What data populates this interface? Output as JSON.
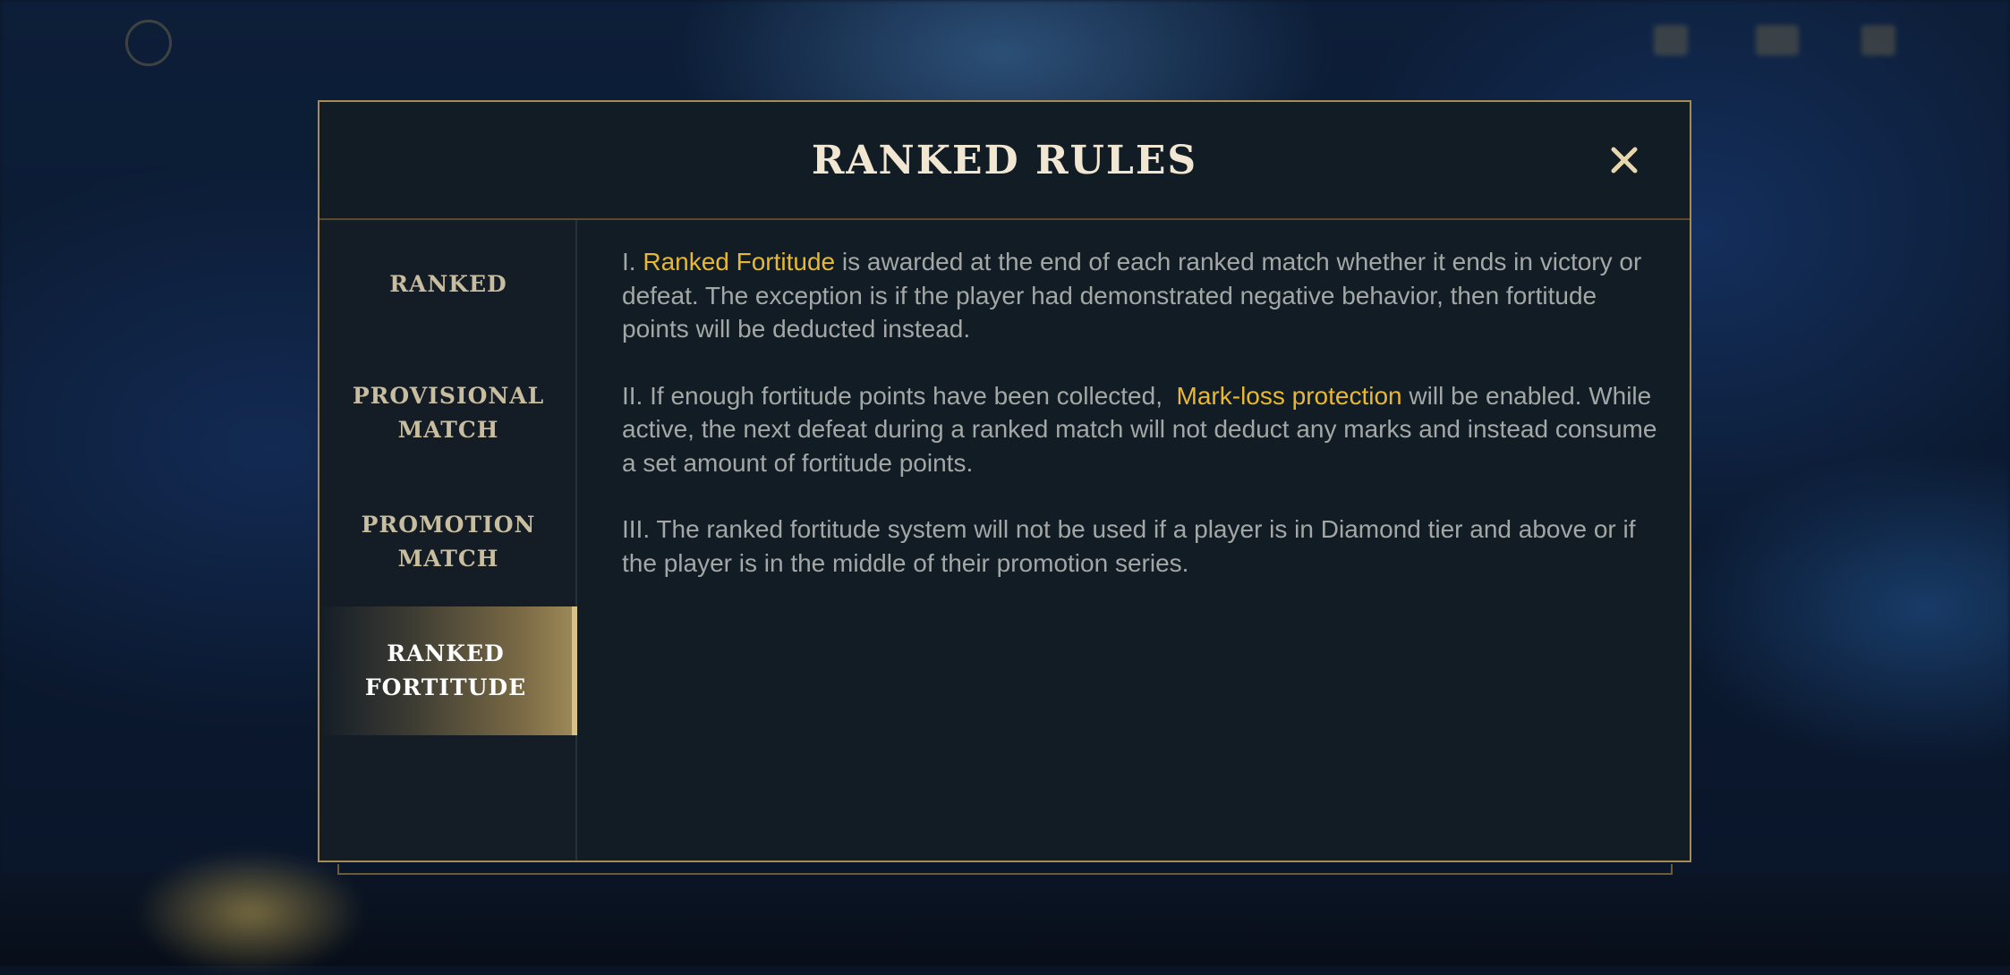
{
  "modal": {
    "title": "RANKED RULES",
    "close_icon": "close-icon"
  },
  "sidebar": {
    "items": [
      {
        "label": "RANKED",
        "active": false
      },
      {
        "label": "PROVISIONAL\nMATCH",
        "active": false
      },
      {
        "label": "PROMOTION\nMATCH",
        "active": false
      },
      {
        "label": "RANKED\nFORTITUDE",
        "active": true
      }
    ]
  },
  "content": {
    "paragraphs": [
      {
        "prefix": "I. ",
        "highlight": "Ranked Fortitude",
        "suffix": " is awarded at the end of each ranked match whether it ends in victory or defeat. The exception is if the player had demonstrated negative behavior, then fortitude points will be deducted instead."
      },
      {
        "prefix": "II. If enough fortitude points have been collected,  ",
        "highlight": "Mark-loss protection",
        "suffix": " will be enabled. While active, the next defeat during a ranked match will not deduct any marks and instead consume a set amount of fortitude points."
      },
      {
        "prefix": "III. The ranked fortitude system will not be used if a player is in Diamond tier and above or if the player is in the middle of their promotion series.",
        "highlight": "",
        "suffix": ""
      }
    ]
  },
  "colors": {
    "accent_gold": "#a78b52",
    "highlight_text": "#e8b832",
    "title_text": "#f0e6d2",
    "body_text": "#a3a8a6",
    "panel_bg": "#121c25"
  }
}
